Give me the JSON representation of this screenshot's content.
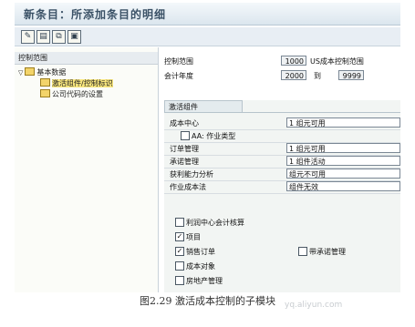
{
  "window": {
    "title": "新条目：所添加条目的明细"
  },
  "toolbar": {
    "buttons": [
      "edit-icon",
      "new-entries-icon",
      "copy-icon",
      "save-icon"
    ]
  },
  "left_panel": {
    "header": "控制范围",
    "tree": [
      {
        "label": "基本数据",
        "level": 0
      },
      {
        "label": "激活组件/控制标识",
        "level": 1,
        "selected": true
      },
      {
        "label": "公司代码的设置",
        "level": 1
      }
    ]
  },
  "header_fields": {
    "controlling_area": {
      "label": "控制范围",
      "value": "1000",
      "desc": "US成本控制范围"
    },
    "fiscal_year": {
      "label": "会计年度",
      "from": "2000",
      "to_label": "到",
      "to": "9999"
    }
  },
  "group": {
    "title": "激活组件",
    "rows": [
      {
        "label": "成本中心",
        "value": "1 组元可用"
      },
      {
        "label": "AA: 作业类型",
        "checkbox": true,
        "checked": false
      },
      {
        "label": "订单管理",
        "value": "1 组元可用"
      },
      {
        "label": "承诺管理",
        "value": "1 组件活动"
      },
      {
        "label": "获利能力分析",
        "value": "组元不可用"
      },
      {
        "label": "作业成本法",
        "value": "组件无效"
      }
    ],
    "checkboxes": [
      {
        "label": "利润中心会计核算",
        "checked": false
      },
      {
        "label": "项目",
        "checked": true
      },
      {
        "label": "销售订单",
        "checked": true
      },
      {
        "label": "带承诺管理",
        "checked": false
      },
      {
        "label": "成本对象",
        "checked": false
      },
      {
        "label": "房地产管理",
        "checked": false
      }
    ]
  },
  "caption": "图2.29  激活成本控制的子模块",
  "watermark": "yq.aliyun.com"
}
